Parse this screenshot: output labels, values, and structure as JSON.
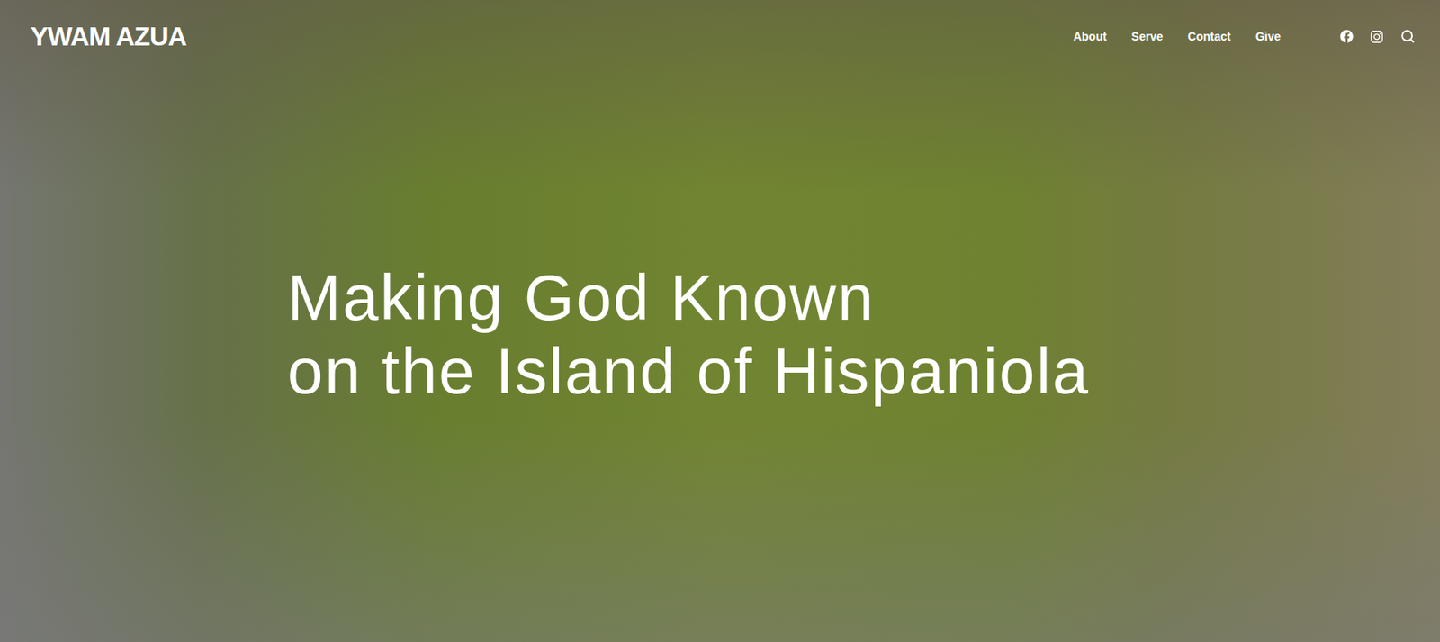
{
  "header": {
    "logo": "YWAM AZUA",
    "nav": [
      {
        "label": "About"
      },
      {
        "label": "Serve"
      },
      {
        "label": "Contact"
      },
      {
        "label": "Give"
      }
    ]
  },
  "hero": {
    "headline_lines": [
      "Making God Known",
      "on the Island of Hispaniola"
    ]
  }
}
